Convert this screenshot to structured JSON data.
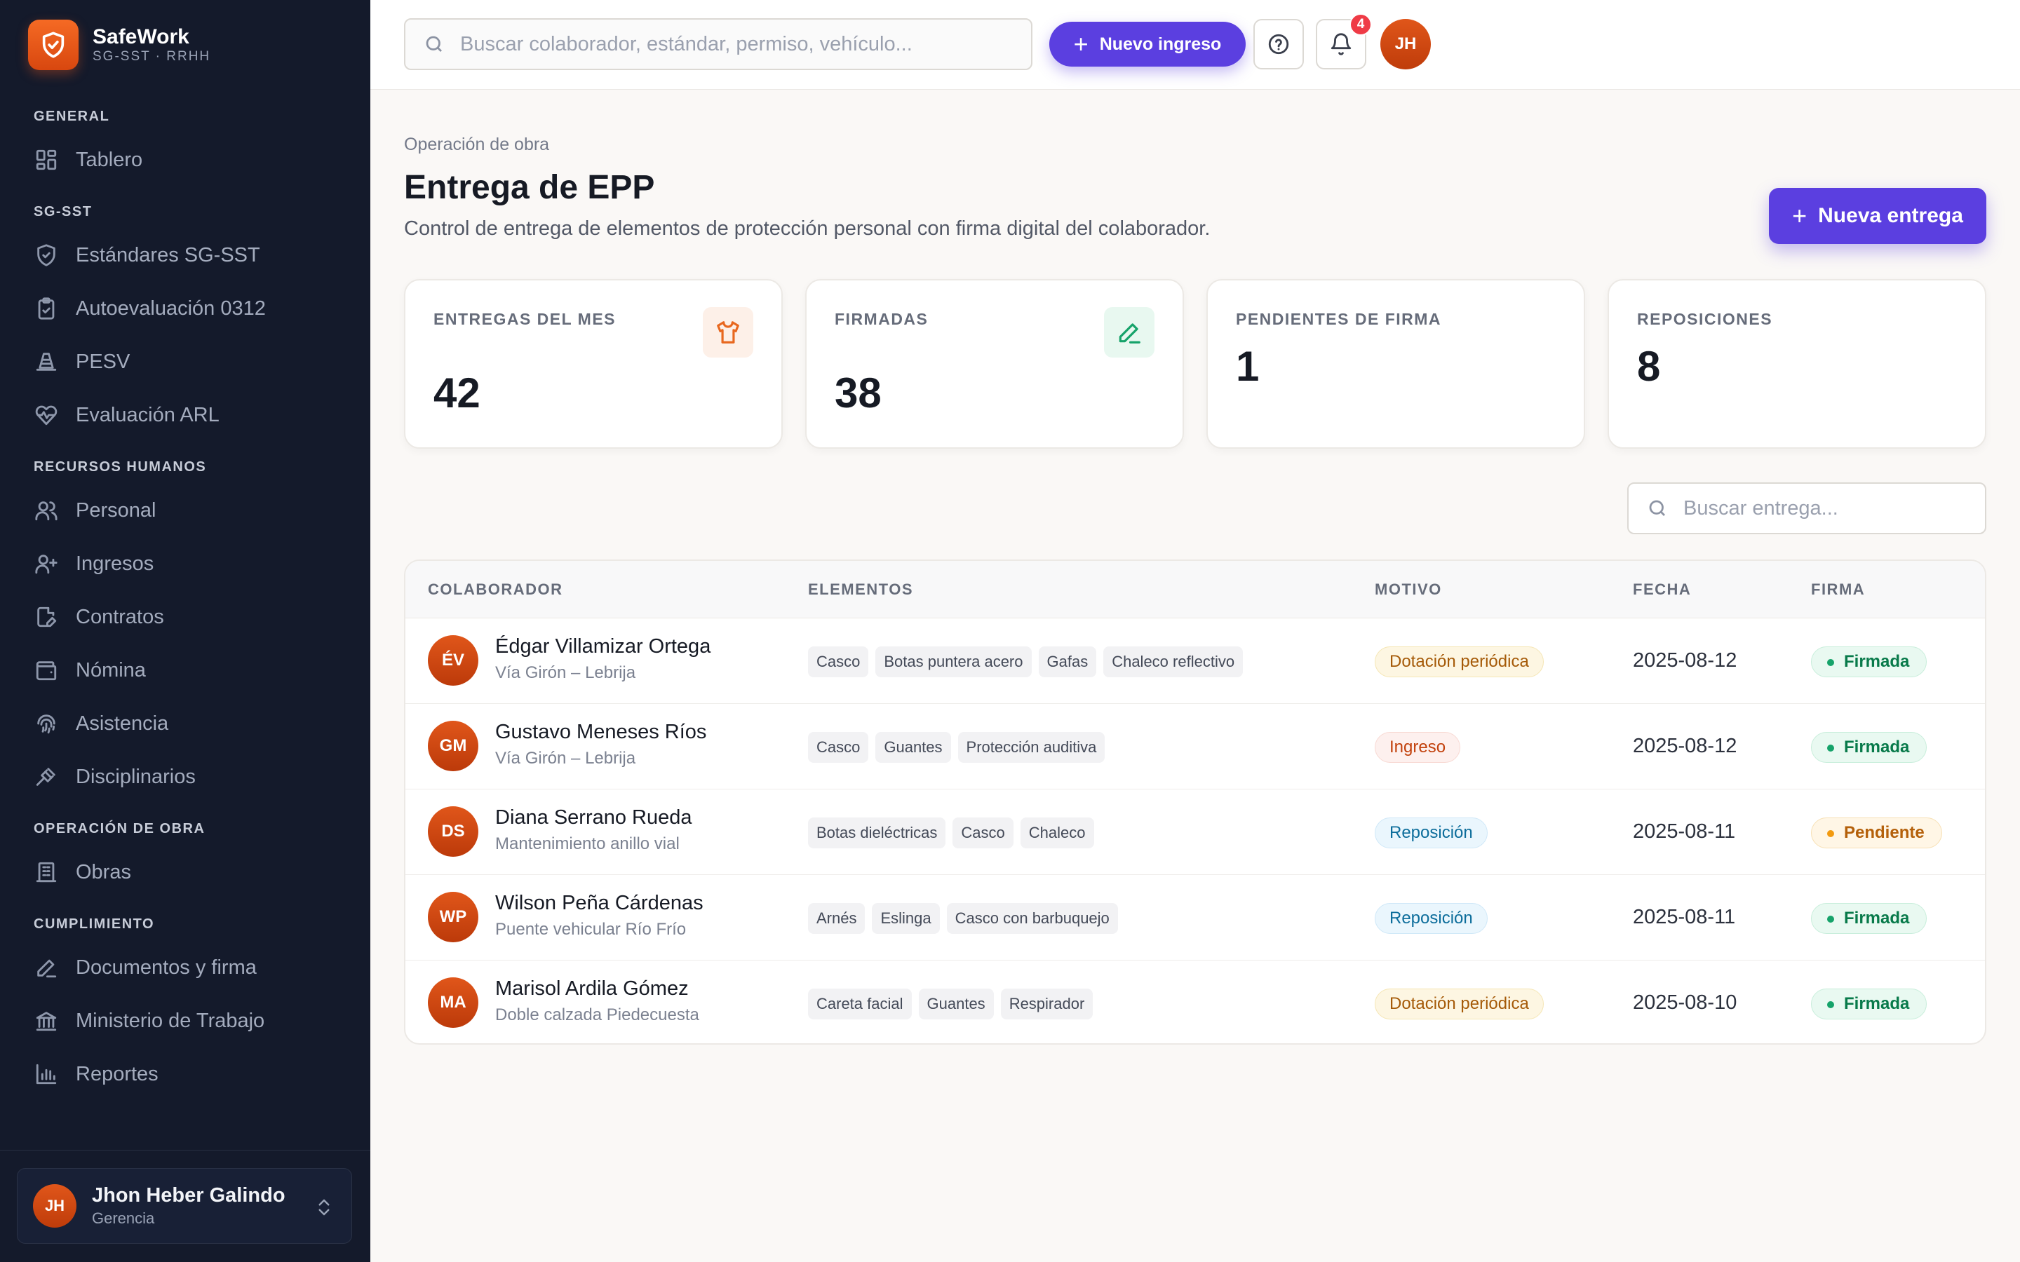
{
  "brand": {
    "name": "SafeWork",
    "sub": "SG-SST · RRHH"
  },
  "sidebar": {
    "sections": [
      {
        "title": "GENERAL",
        "items": [
          {
            "label": "Tablero",
            "icon": "grid-icon"
          }
        ]
      },
      {
        "title": "SG-SST",
        "items": [
          {
            "label": "Estándares SG-SST",
            "icon": "shield-check-icon"
          },
          {
            "label": "Autoevaluación 0312",
            "icon": "clipboard-check-icon"
          },
          {
            "label": "PESV",
            "icon": "traffic-cone-icon"
          },
          {
            "label": "Evaluación ARL",
            "icon": "heart-pulse-icon"
          }
        ]
      },
      {
        "title": "RECURSOS HUMANOS",
        "items": [
          {
            "label": "Personal",
            "icon": "users-icon"
          },
          {
            "label": "Ingresos",
            "icon": "user-plus-icon"
          },
          {
            "label": "Contratos",
            "icon": "file-edit-icon"
          },
          {
            "label": "Nómina",
            "icon": "wallet-icon"
          },
          {
            "label": "Asistencia",
            "icon": "fingerprint-icon"
          },
          {
            "label": "Disciplinarios",
            "icon": "gavel-icon"
          }
        ]
      },
      {
        "title": "OPERACIÓN DE OBRA",
        "items": [
          {
            "label": "Obras",
            "icon": "building-icon"
          }
        ]
      },
      {
        "title": "CUMPLIMIENTO",
        "items": [
          {
            "label": "Documentos y firma",
            "icon": "pen-icon"
          },
          {
            "label": "Ministerio de Trabajo",
            "icon": "landmark-icon"
          },
          {
            "label": "Reportes",
            "icon": "bar-chart-icon"
          }
        ]
      }
    ],
    "user": {
      "initials": "JH",
      "name": "Jhon Heber Galindo",
      "role": "Gerencia"
    }
  },
  "topbar": {
    "search_placeholder": "Buscar colaborador, estándar, permiso, vehículo...",
    "new_button": "Nuevo ingreso",
    "notifications_count": "4",
    "avatar_initials": "JH"
  },
  "page": {
    "breadcrumb": "Operación de obra",
    "title": "Entrega de EPP",
    "subtitle": "Control de entrega de elementos de protección personal con firma digital del colaborador.",
    "new_button": "Nueva entrega",
    "search_placeholder": "Buscar entrega..."
  },
  "kpis": [
    {
      "label": "ENTREGAS DEL MES",
      "value": "42",
      "icon": "shirt-icon",
      "icon_color": "#e8681f",
      "icon_bg": "#fdf0e8"
    },
    {
      "label": "FIRMADAS",
      "value": "38",
      "icon": "pen-icon",
      "icon_color": "#16a36a",
      "icon_bg": "#e8f8f0"
    },
    {
      "label": "PENDIENTES DE FIRMA",
      "value": "1"
    },
    {
      "label": "REPOSICIONES",
      "value": "8"
    }
  ],
  "table": {
    "columns": [
      "COLABORADOR",
      "ELEMENTOS",
      "MOTIVO",
      "FECHA",
      "FIRMA"
    ],
    "rows": [
      {
        "initials": "ÉV",
        "name": "Édgar Villamizar Ortega",
        "place": "Vía Girón – Lebrija",
        "items": [
          "Casco",
          "Botas puntera acero",
          "Gafas",
          "Chaleco reflectivo"
        ],
        "motivo": "Dotación periódica",
        "motivo_kind": "dot",
        "fecha": "2025-08-12",
        "firma": "Firmada",
        "firma_kind": "ok"
      },
      {
        "initials": "GM",
        "name": "Gustavo Meneses Ríos",
        "place": "Vía Girón – Lebrija",
        "items": [
          "Casco",
          "Guantes",
          "Protección auditiva"
        ],
        "motivo": "Ingreso",
        "motivo_kind": "ing",
        "fecha": "2025-08-12",
        "firma": "Firmada",
        "firma_kind": "ok"
      },
      {
        "initials": "DS",
        "name": "Diana Serrano Rueda",
        "place": "Mantenimiento anillo vial",
        "items": [
          "Botas dieléctricas",
          "Casco",
          "Chaleco"
        ],
        "motivo": "Reposición",
        "motivo_kind": "rep",
        "fecha": "2025-08-11",
        "firma": "Pendiente",
        "firma_kind": "pend"
      },
      {
        "initials": "WP",
        "name": "Wilson Peña Cárdenas",
        "place": "Puente vehicular Río Frío",
        "items": [
          "Arnés",
          "Eslinga",
          "Casco con barbuquejo"
        ],
        "motivo": "Reposición",
        "motivo_kind": "rep",
        "fecha": "2025-08-11",
        "firma": "Firmada",
        "firma_kind": "ok"
      },
      {
        "initials": "MA",
        "name": "Marisol Ardila Gómez",
        "place": "Doble calzada Piedecuesta",
        "items": [
          "Careta facial",
          "Guantes",
          "Respirador"
        ],
        "motivo": "Dotación periódica",
        "motivo_kind": "dot",
        "fecha": "2025-08-10",
        "firma": "Firmada",
        "firma_kind": "ok"
      }
    ]
  }
}
